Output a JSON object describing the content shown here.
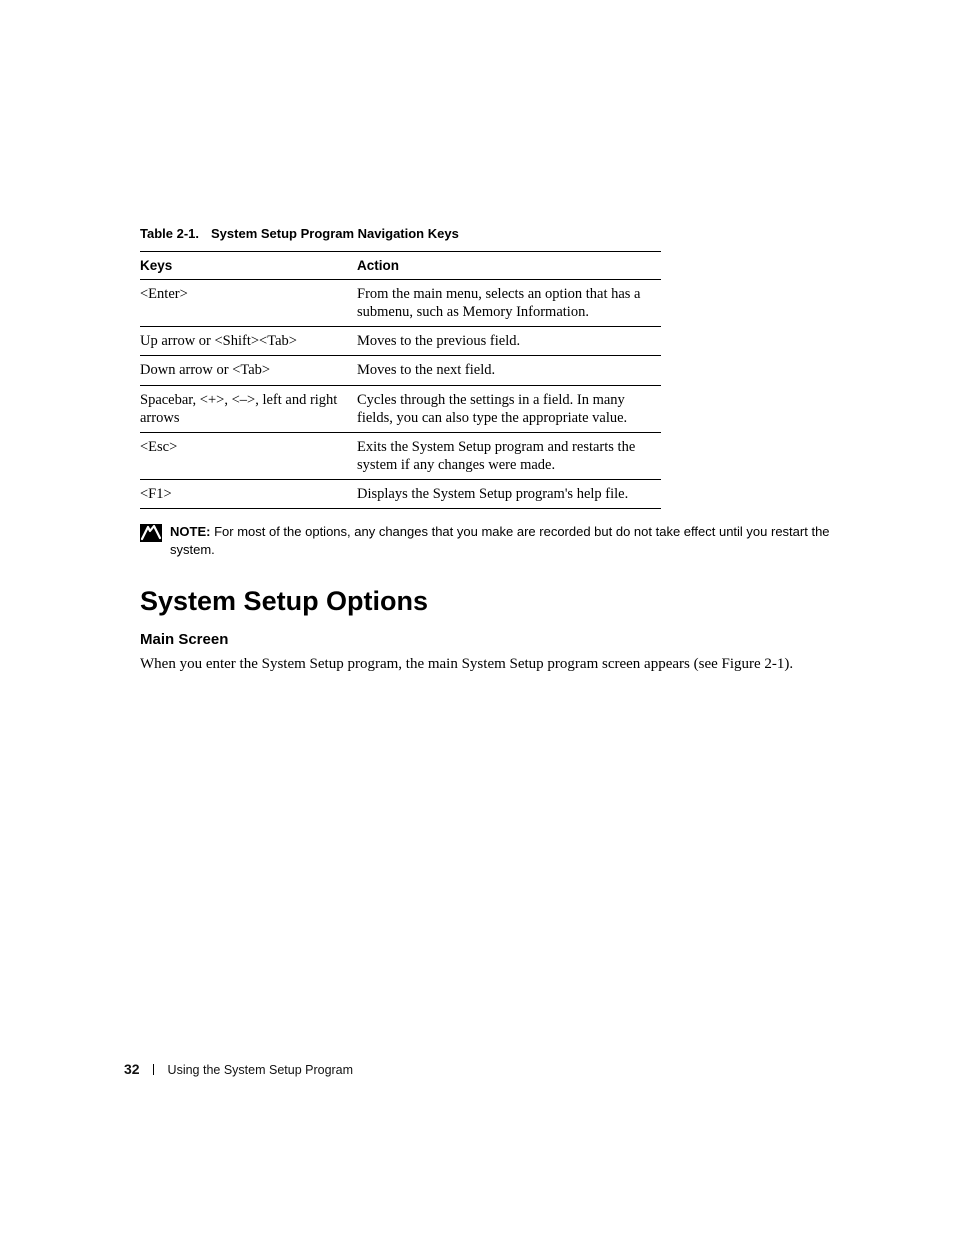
{
  "table": {
    "caption_number": "Table 2-1.",
    "caption_title": "System Setup Program Navigation Keys",
    "headers": {
      "col1": "Keys",
      "col2": "Action"
    },
    "rows": [
      {
        "key": "<Enter>",
        "action": "From the main menu, selects an option that has a submenu, such as Memory Information."
      },
      {
        "key": "Up arrow or <Shift><Tab>",
        "action": "Moves to the previous field."
      },
      {
        "key": "Down arrow or <Tab>",
        "action": "Moves to the next field."
      },
      {
        "key": "Spacebar, <+>, <–>, left and right arrows",
        "action": "Cycles through the settings in a field. In many fields, you can also type the appropriate value."
      },
      {
        "key": "<Esc>",
        "action": "Exits the System Setup program and restarts the system if any changes were made."
      },
      {
        "key": "<F1>",
        "action": "Displays the System Setup program's help file."
      }
    ]
  },
  "note": {
    "label": "NOTE:",
    "text": "For most of the options, any changes that you make are recorded but do not take effect until you restart the system."
  },
  "section_heading": "System Setup Options",
  "subsection_heading": "Main Screen",
  "body_paragraph": "When you enter the System Setup program, the main System Setup program screen appears (see Figure 2-1).",
  "footer": {
    "page_number": "32",
    "chapter_title": "Using the System Setup Program"
  }
}
